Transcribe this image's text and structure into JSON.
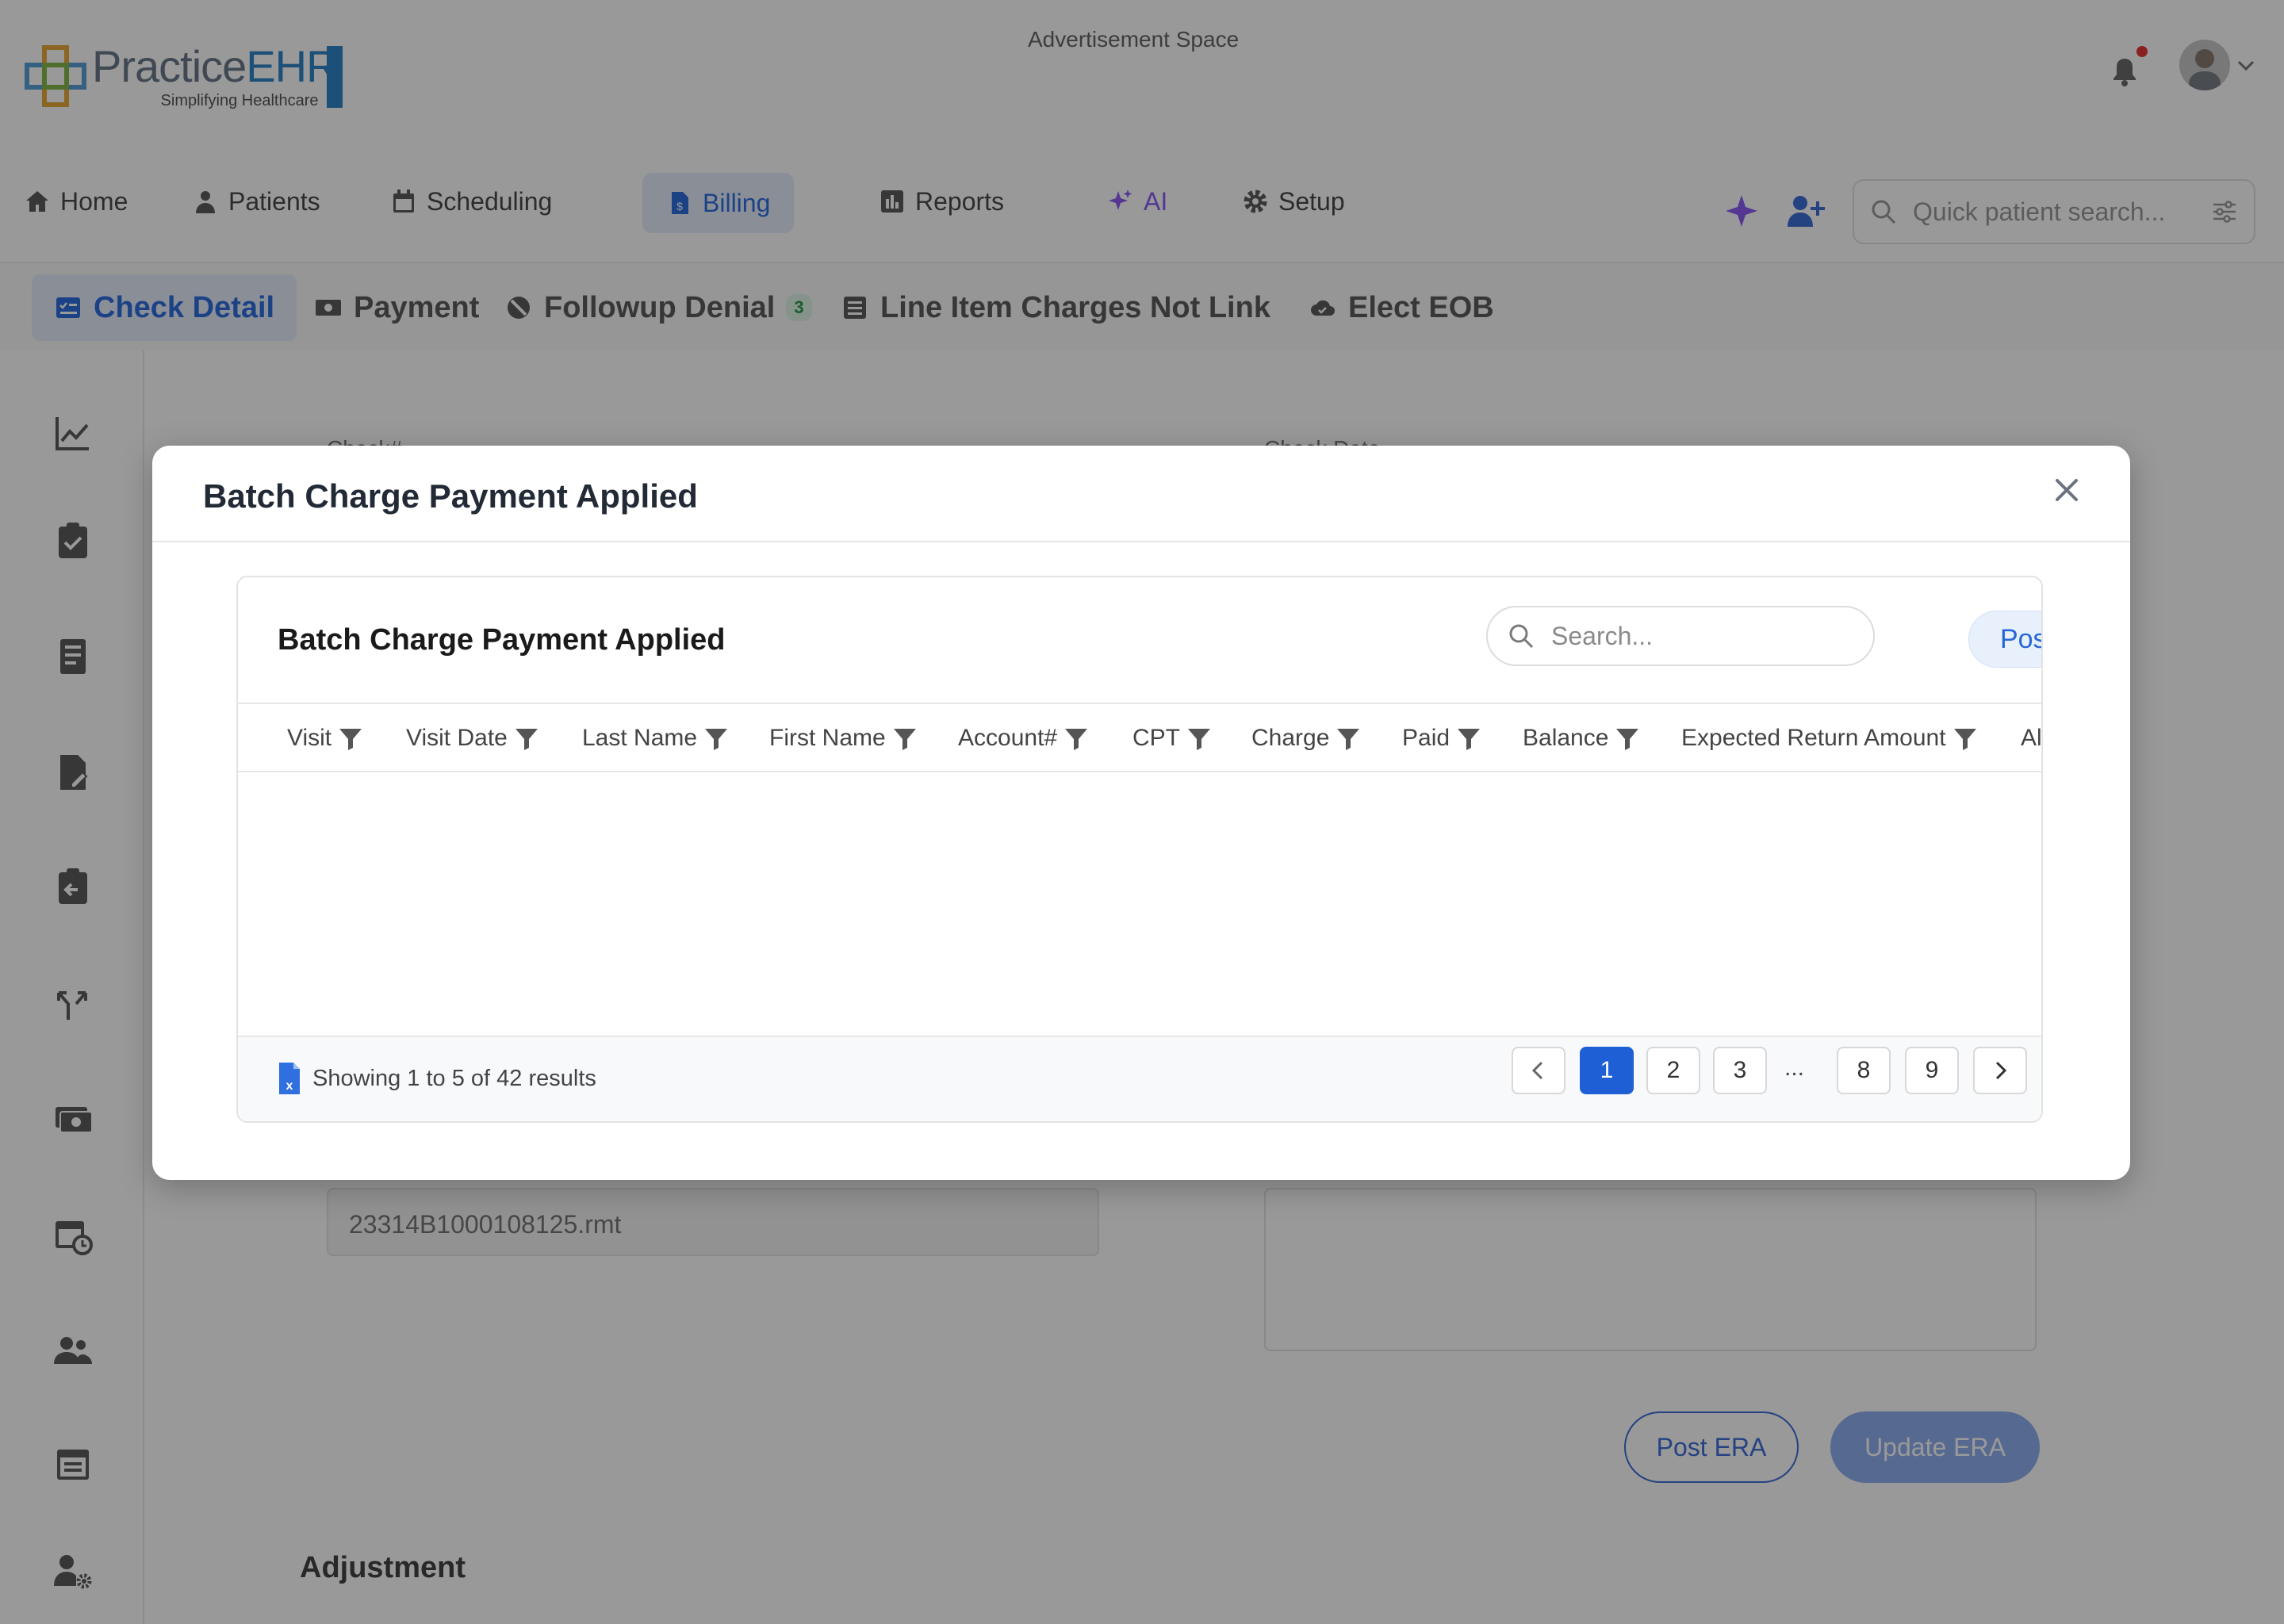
{
  "header": {
    "logo_word_a": "Practice",
    "logo_word_b": "EHR",
    "logo_tagline": "Simplifying Healthcare",
    "ad_space": "Advertisement Space"
  },
  "nav": {
    "items": [
      {
        "label": "Home",
        "icon": "home-icon"
      },
      {
        "label": "Patients",
        "icon": "patients-icon"
      },
      {
        "label": "Scheduling",
        "icon": "calendar-icon"
      },
      {
        "label": "Billing",
        "icon": "billing-icon",
        "active": true
      },
      {
        "label": "Reports",
        "icon": "reports-icon"
      },
      {
        "label": "AI",
        "icon": "sparkle-icon"
      },
      {
        "label": "Setup",
        "icon": "gear-icon"
      }
    ],
    "quick_search_placeholder": "Quick patient search..."
  },
  "subtabs": [
    {
      "label": "Check Detail",
      "active": true
    },
    {
      "label": "Payment"
    },
    {
      "label": "Followup Denial",
      "badge": "3"
    },
    {
      "label": "Line Item Charges Not Link"
    },
    {
      "label": "Elect EOB"
    }
  ],
  "background_form": {
    "check_label": "Check#",
    "check_date_label": "Check Date",
    "file_value": "23314B1000108125.rmt",
    "post_era": "Post ERA",
    "update_era": "Update ERA",
    "adjustment_title": "Adjustment"
  },
  "modal": {
    "title": "Batch Charge Payment Applied",
    "card_title": "Batch Charge Payment Applied",
    "search_placeholder": "Search...",
    "post_label": "Post",
    "columns": [
      "Visit",
      "Visit Date",
      "Last Name",
      "First Name",
      "Account#",
      "CPT",
      "Charge",
      "Paid",
      "Balance",
      "Expected Return Amount",
      "Al"
    ],
    "rows": [],
    "showing_text": "Showing 1 to 5 of 42 results",
    "pagination": {
      "pages": [
        "1",
        "2",
        "3",
        "...",
        "8",
        "9"
      ],
      "current": "1"
    }
  },
  "colors": {
    "primary": "#1f5fd6",
    "accent_ai": "#8a5cf5",
    "badge_green": "#2d9a4f"
  }
}
